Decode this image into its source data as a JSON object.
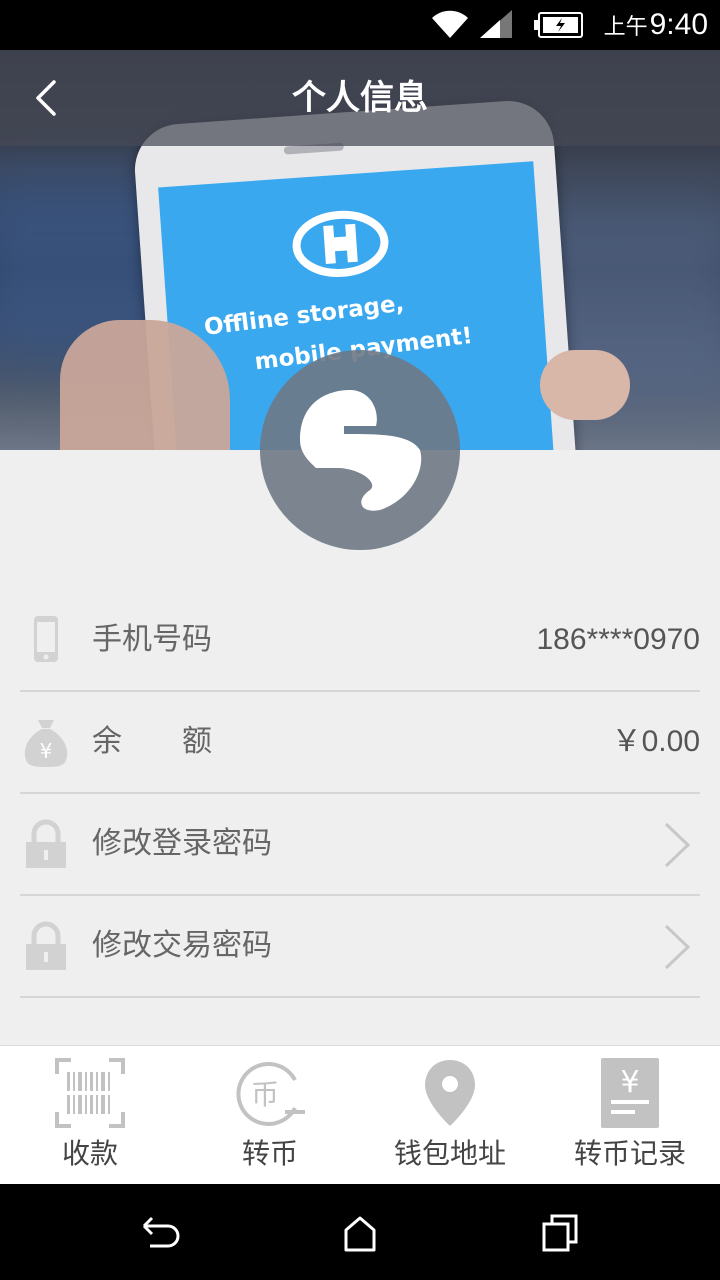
{
  "status_bar": {
    "ampm": "上午",
    "time": "9:40"
  },
  "header": {
    "title": "个人信息"
  },
  "hero": {
    "screen_line1": "Offline storage,",
    "screen_line2": "mobile payment!"
  },
  "rows": [
    {
      "icon": "phone-icon",
      "label": "手机号码",
      "value": "186****0970"
    },
    {
      "icon": "money-bag-icon",
      "label": "余　　额",
      "value": "￥0.00"
    },
    {
      "icon": "lock-icon",
      "label": "修改登录密码"
    },
    {
      "icon": "lock-icon",
      "label": "修改交易密码"
    }
  ],
  "bottom_nav": [
    {
      "icon": "barcode-scan-icon",
      "label": "收款"
    },
    {
      "icon": "coin-transfer-icon",
      "label": "转币"
    },
    {
      "icon": "location-pin-icon",
      "label": "钱包地址"
    },
    {
      "icon": "receipt-icon",
      "label": "转币记录"
    }
  ],
  "colors": {
    "accent_screen": "#3aa8ef",
    "icon_gray": "#bdbdbd",
    "background": "#efefef"
  }
}
